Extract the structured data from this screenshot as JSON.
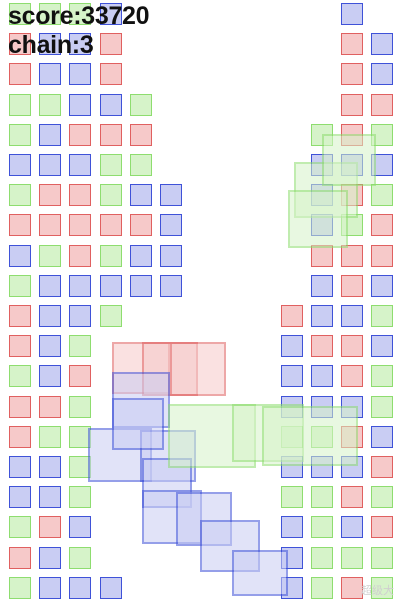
{
  "hud": {
    "score_label": "score:",
    "score_value": "33720",
    "chain_label": "chain:",
    "chain_value": "3"
  },
  "colors": {
    "red_fill": "#f6c9c9",
    "red_border": "#e06060",
    "blue_fill": "#c9cdf3",
    "blue_border": "#3f52d8",
    "green_fill": "#d6f3c9",
    "green_border": "#8edd6f"
  },
  "board": {
    "columns": 13,
    "rows": 20,
    "cells": [
      "GGGB.......B.",
      "RBBR.......RB",
      "RBBR.......RB",
      "GGBBG......RR",
      "GBRRR.....GRG",
      "BBBGG.....BBB",
      "GRRGBB....BRG",
      "RRRRRB....BGR",
      "BGRGBB....RRR",
      "GBBBBB....BRB",
      "RBBG.....RBBG",
      "RBG......BRRB",
      "GBR......BBRG",
      "RRG......BBBG",
      "RGG......GGRB",
      "BBG......BBBR",
      "BBG......GGRG",
      "GRB......BGBR",
      "RBG......BGGG",
      "GBBB.....BGRG"
    ]
  },
  "falling_blocks": [
    {
      "color": "red"
    },
    {
      "color": "red"
    },
    {
      "color": "red"
    },
    {
      "color": "blue"
    },
    {
      "color": "blue"
    },
    {
      "color": "blue"
    },
    {
      "color": "blue"
    },
    {
      "color": "blue"
    },
    {
      "color": "green"
    },
    {
      "color": "green"
    },
    {
      "color": "green"
    },
    {
      "color": "green"
    },
    {
      "color": "green"
    },
    {
      "color": "green"
    },
    {
      "color": "blue"
    },
    {
      "color": "blue"
    },
    {
      "color": "blue"
    },
    {
      "color": "blue"
    }
  ],
  "watermark": "超级大"
}
